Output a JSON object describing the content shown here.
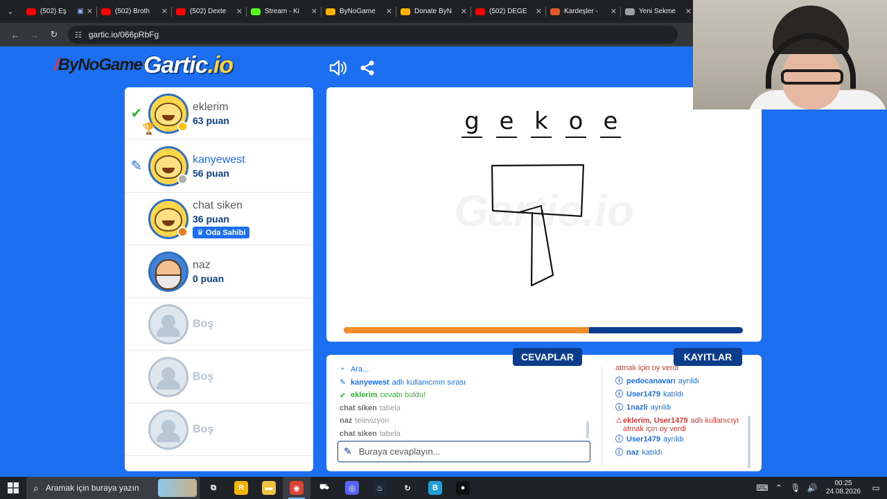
{
  "browser": {
    "tabs": [
      {
        "title": "(502) Eş",
        "color": "#ff0000",
        "extra": "▣"
      },
      {
        "title": "(502) Broth",
        "color": "#ff0000"
      },
      {
        "title": "(502) Dexte",
        "color": "#ff0000"
      },
      {
        "title": "Stream - Ki",
        "color": "#53fc18"
      },
      {
        "title": "ByNoGame",
        "color": "#ffb300"
      },
      {
        "title": "Donate ByN",
        "color": "#ffb300"
      },
      {
        "title": "(502) DEĞE",
        "color": "#ff0000"
      },
      {
        "title": "Kardeşler -",
        "color": "#e05a2b"
      },
      {
        "title": "Yeni Sekme",
        "color": "#9aa0a6"
      }
    ],
    "url": "gartic.io/066pRbFg"
  },
  "header": {
    "sponsor": "ByNoGame",
    "logo_main": "Gartic",
    "logo_suffix": ".io"
  },
  "players": [
    {
      "name": "eklerim",
      "score": "63 puan",
      "marker": "check",
      "avatar": "yellow",
      "dot": "#ffc107",
      "trophy": true
    },
    {
      "name": "kanyewest",
      "score": "56 puan",
      "marker": "pen",
      "avatar": "yellow",
      "dot": "#b0b0b0",
      "turn": true
    },
    {
      "name": "chat siken",
      "score": "36 puan",
      "avatar": "yellow",
      "dot": "#e67e22",
      "badge": "Oda Sahibi"
    },
    {
      "name": "naz",
      "score": "0 puan",
      "avatar": "naz"
    }
  ],
  "empty_slot_label": "Boş",
  "empty_slots": 3,
  "canvas": {
    "hint_letters": [
      "g",
      "e",
      "k",
      "o",
      "e"
    ],
    "timer_progress": 0.615
  },
  "tabs": {
    "answers": "CEVAPLAR",
    "logs": "KAYITLAR"
  },
  "answers": [
    {
      "icon": "◔",
      "user": "",
      "text": "Ara...",
      "color": "blue"
    },
    {
      "icon": "✎",
      "user": "kanyewest",
      "text": "adlı kullanıcının sırası",
      "color": "blue"
    },
    {
      "icon": "✔",
      "user": "eklerim",
      "text": "cevabı buldu!",
      "color": "green"
    },
    {
      "icon": "",
      "user": "chat siken",
      "text": "tabela",
      "color": "grey"
    },
    {
      "icon": "",
      "user": "naz",
      "text": "televizyon",
      "color": "grey"
    },
    {
      "icon": "",
      "user": "chat siken",
      "text": "tabela",
      "color": "grey"
    }
  ],
  "answer_placeholder": "Buraya cevaplayın...",
  "logs": [
    {
      "icon": "",
      "user": "",
      "text": "atmak için oy verdi",
      "color": "red"
    },
    {
      "icon": "ⓘ",
      "user": "pedocanavarı",
      "text": "ayrıldı",
      "color": "blue"
    },
    {
      "icon": "ⓘ",
      "user": "User1479",
      "text": "katıldı",
      "color": "blue"
    },
    {
      "icon": "ⓘ",
      "user": "1nazli",
      "text": "ayrıldı",
      "color": "blue"
    },
    {
      "icon": "⚠",
      "user": "eklerim, User1479",
      "text": "adlı kullanıcıyı atmak için oy verdi",
      "color": "red"
    },
    {
      "icon": "ⓘ",
      "user": "User1479",
      "text": "ayrıldı",
      "color": "blue"
    },
    {
      "icon": "ⓘ",
      "user": "naz",
      "text": "katıldı",
      "color": "blue"
    }
  ],
  "taskbar": {
    "search_placeholder": "Aramak için buraya yazın",
    "apps": [
      {
        "name": "task-view",
        "glyph": "⧉",
        "color": "transparent"
      },
      {
        "name": "rockstar",
        "glyph": "R",
        "color": "#f6b400"
      },
      {
        "name": "file-explorer",
        "glyph": "▬",
        "color": "#f0c040"
      },
      {
        "name": "chrome",
        "glyph": "◉",
        "color": "#db4437",
        "active": true
      },
      {
        "name": "app-drive",
        "glyph": "⛟",
        "color": "transparent"
      },
      {
        "name": "discord",
        "glyph": "◎",
        "color": "#5865f2"
      },
      {
        "name": "steam",
        "glyph": "♨",
        "color": "#1b2838"
      },
      {
        "name": "app-green",
        "glyph": "↻",
        "color": "transparent"
      },
      {
        "name": "app-b",
        "glyph": "B",
        "color": "#1fa0d8"
      },
      {
        "name": "obs",
        "glyph": "●",
        "color": "#111111"
      }
    ],
    "time": "00:25",
    "date": "24.08.2026"
  }
}
